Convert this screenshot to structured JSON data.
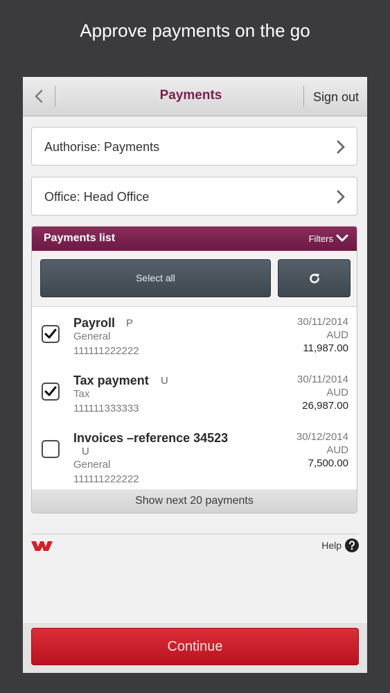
{
  "caption": "Approve payments on the go",
  "header": {
    "title": "Payments",
    "sign_out": "Sign out"
  },
  "selectors": [
    {
      "label": "Authorise: Payments"
    },
    {
      "label": "Office: Head Office"
    }
  ],
  "payments_list": {
    "title": "Payments list",
    "filters_label": "Filters",
    "select_all_label": "Select all",
    "rows": [
      {
        "name": "Payroll",
        "tag": "P",
        "sub": "General",
        "account": "111111222222",
        "date": "30/11/2014",
        "currency": "AUD",
        "amount": "11,987.00",
        "checked": true
      },
      {
        "name": "Tax payment",
        "tag": "U",
        "sub": "Tax",
        "account": "111111333333",
        "date": "30/11/2014",
        "currency": "AUD",
        "amount": "26,987.00",
        "checked": true
      },
      {
        "name": "Invoices –reference 34523",
        "tag": "U",
        "sub": "General",
        "account": "111111222222",
        "date": "30/12/2014",
        "currency": "AUD",
        "amount": "7,500.00",
        "checked": false
      }
    ],
    "show_next_label": "Show next 20 payments"
  },
  "footer": {
    "help_label": "Help"
  },
  "continue_label": "Continue",
  "colors": {
    "brand": "#7a1f4c",
    "list_header": "#7a2350",
    "continue": "#cc1f2b",
    "dark_button": "#4a545c"
  },
  "icons": [
    "back-chevron-icon",
    "chevron-right-icon",
    "chevron-down-icon",
    "refresh-icon",
    "checkmark-icon",
    "help-icon",
    "bank-logo-icon"
  ]
}
